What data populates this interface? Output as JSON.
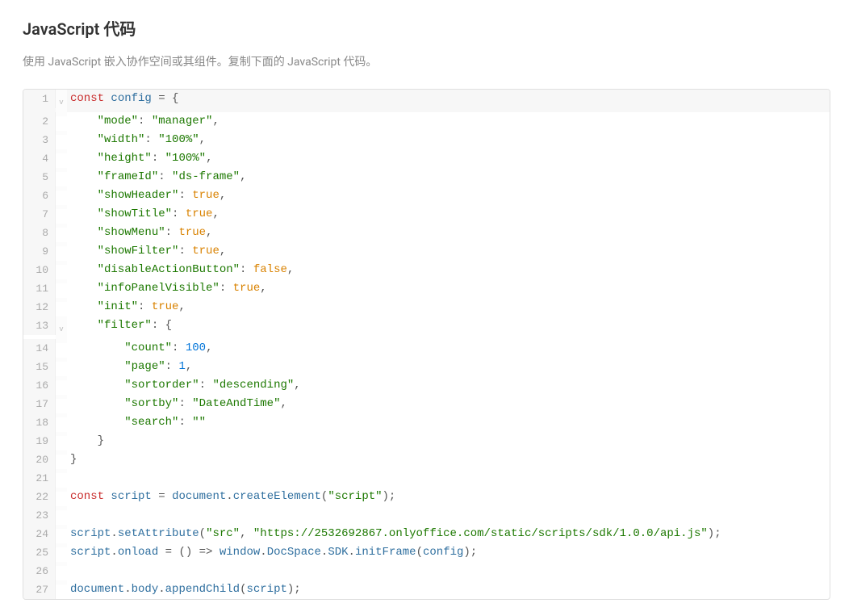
{
  "title": "JavaScript 代码",
  "description": "使用 JavaScript 嵌入协作空间或其组件。复制下面的 JavaScript 代码。",
  "code": {
    "lines": [
      {
        "n": 1,
        "fold": "v",
        "hl": true,
        "tokens": [
          [
            "kw",
            "const"
          ],
          [
            "punc",
            " "
          ],
          [
            "var",
            "config"
          ],
          [
            "punc",
            " = {"
          ]
        ]
      },
      {
        "n": 2,
        "tokens": [
          [
            "punc",
            "    "
          ],
          [
            "str",
            "\"mode\""
          ],
          [
            "punc",
            ": "
          ],
          [
            "str",
            "\"manager\""
          ],
          [
            "punc",
            ","
          ]
        ]
      },
      {
        "n": 3,
        "tokens": [
          [
            "punc",
            "    "
          ],
          [
            "str",
            "\"width\""
          ],
          [
            "punc",
            ": "
          ],
          [
            "str",
            "\"100%\""
          ],
          [
            "punc",
            ","
          ]
        ]
      },
      {
        "n": 4,
        "tokens": [
          [
            "punc",
            "    "
          ],
          [
            "str",
            "\"height\""
          ],
          [
            "punc",
            ": "
          ],
          [
            "str",
            "\"100%\""
          ],
          [
            "punc",
            ","
          ]
        ]
      },
      {
        "n": 5,
        "tokens": [
          [
            "punc",
            "    "
          ],
          [
            "str",
            "\"frameId\""
          ],
          [
            "punc",
            ": "
          ],
          [
            "str",
            "\"ds-frame\""
          ],
          [
            "punc",
            ","
          ]
        ]
      },
      {
        "n": 6,
        "tokens": [
          [
            "punc",
            "    "
          ],
          [
            "str",
            "\"showHeader\""
          ],
          [
            "punc",
            ": "
          ],
          [
            "bool",
            "true"
          ],
          [
            "punc",
            ","
          ]
        ]
      },
      {
        "n": 7,
        "tokens": [
          [
            "punc",
            "    "
          ],
          [
            "str",
            "\"showTitle\""
          ],
          [
            "punc",
            ": "
          ],
          [
            "bool",
            "true"
          ],
          [
            "punc",
            ","
          ]
        ]
      },
      {
        "n": 8,
        "tokens": [
          [
            "punc",
            "    "
          ],
          [
            "str",
            "\"showMenu\""
          ],
          [
            "punc",
            ": "
          ],
          [
            "bool",
            "true"
          ],
          [
            "punc",
            ","
          ]
        ]
      },
      {
        "n": 9,
        "tokens": [
          [
            "punc",
            "    "
          ],
          [
            "str",
            "\"showFilter\""
          ],
          [
            "punc",
            ": "
          ],
          [
            "bool",
            "true"
          ],
          [
            "punc",
            ","
          ]
        ]
      },
      {
        "n": 10,
        "tokens": [
          [
            "punc",
            "    "
          ],
          [
            "str",
            "\"disableActionButton\""
          ],
          [
            "punc",
            ": "
          ],
          [
            "bool",
            "false"
          ],
          [
            "punc",
            ","
          ]
        ]
      },
      {
        "n": 11,
        "tokens": [
          [
            "punc",
            "    "
          ],
          [
            "str",
            "\"infoPanelVisible\""
          ],
          [
            "punc",
            ": "
          ],
          [
            "bool",
            "true"
          ],
          [
            "punc",
            ","
          ]
        ]
      },
      {
        "n": 12,
        "tokens": [
          [
            "punc",
            "    "
          ],
          [
            "str",
            "\"init\""
          ],
          [
            "punc",
            ": "
          ],
          [
            "bool",
            "true"
          ],
          [
            "punc",
            ","
          ]
        ]
      },
      {
        "n": 13,
        "fold": "v",
        "tokens": [
          [
            "punc",
            "    "
          ],
          [
            "str",
            "\"filter\""
          ],
          [
            "punc",
            ": {"
          ]
        ]
      },
      {
        "n": 14,
        "tokens": [
          [
            "punc",
            "        "
          ],
          [
            "str",
            "\"count\""
          ],
          [
            "punc",
            ": "
          ],
          [
            "num",
            "100"
          ],
          [
            "punc",
            ","
          ]
        ]
      },
      {
        "n": 15,
        "tokens": [
          [
            "punc",
            "        "
          ],
          [
            "str",
            "\"page\""
          ],
          [
            "punc",
            ": "
          ],
          [
            "num",
            "1"
          ],
          [
            "punc",
            ","
          ]
        ]
      },
      {
        "n": 16,
        "tokens": [
          [
            "punc",
            "        "
          ],
          [
            "str",
            "\"sortorder\""
          ],
          [
            "punc",
            ": "
          ],
          [
            "str",
            "\"descending\""
          ],
          [
            "punc",
            ","
          ]
        ]
      },
      {
        "n": 17,
        "tokens": [
          [
            "punc",
            "        "
          ],
          [
            "str",
            "\"sortby\""
          ],
          [
            "punc",
            ": "
          ],
          [
            "str",
            "\"DateAndTime\""
          ],
          [
            "punc",
            ","
          ]
        ]
      },
      {
        "n": 18,
        "tokens": [
          [
            "punc",
            "        "
          ],
          [
            "str",
            "\"search\""
          ],
          [
            "punc",
            ": "
          ],
          [
            "str",
            "\"\""
          ]
        ]
      },
      {
        "n": 19,
        "tokens": [
          [
            "punc",
            "    }"
          ]
        ]
      },
      {
        "n": 20,
        "tokens": [
          [
            "punc",
            "}"
          ]
        ]
      },
      {
        "n": 21,
        "tokens": [
          [
            "punc",
            ""
          ]
        ]
      },
      {
        "n": 22,
        "tokens": [
          [
            "kw",
            "const"
          ],
          [
            "punc",
            " "
          ],
          [
            "var",
            "script"
          ],
          [
            "punc",
            " = "
          ],
          [
            "var",
            "document"
          ],
          [
            "punc",
            "."
          ],
          [
            "func",
            "createElement"
          ],
          [
            "punc",
            "("
          ],
          [
            "str",
            "\"script\""
          ],
          [
            "punc",
            ");"
          ]
        ]
      },
      {
        "n": 23,
        "tokens": [
          [
            "punc",
            ""
          ]
        ]
      },
      {
        "n": 24,
        "tokens": [
          [
            "var",
            "script"
          ],
          [
            "punc",
            "."
          ],
          [
            "func",
            "setAttribute"
          ],
          [
            "punc",
            "("
          ],
          [
            "str",
            "\"src\""
          ],
          [
            "punc",
            ", "
          ],
          [
            "str",
            "\"https://2532692867.onlyoffice.com/static/scripts/sdk/1.0.0/api.js\""
          ],
          [
            "punc",
            ");"
          ]
        ]
      },
      {
        "n": 25,
        "tokens": [
          [
            "var",
            "script"
          ],
          [
            "punc",
            "."
          ],
          [
            "var",
            "onload"
          ],
          [
            "punc",
            " = () => "
          ],
          [
            "var",
            "window"
          ],
          [
            "punc",
            "."
          ],
          [
            "var",
            "DocSpace"
          ],
          [
            "punc",
            "."
          ],
          [
            "var",
            "SDK"
          ],
          [
            "punc",
            "."
          ],
          [
            "func",
            "initFrame"
          ],
          [
            "punc",
            "("
          ],
          [
            "var",
            "config"
          ],
          [
            "punc",
            ");"
          ]
        ]
      },
      {
        "n": 26,
        "tokens": [
          [
            "punc",
            ""
          ]
        ]
      },
      {
        "n": 27,
        "tokens": [
          [
            "var",
            "document"
          ],
          [
            "punc",
            "."
          ],
          [
            "var",
            "body"
          ],
          [
            "punc",
            "."
          ],
          [
            "func",
            "appendChild"
          ],
          [
            "punc",
            "("
          ],
          [
            "var",
            "script"
          ],
          [
            "punc",
            ");"
          ]
        ]
      }
    ]
  }
}
